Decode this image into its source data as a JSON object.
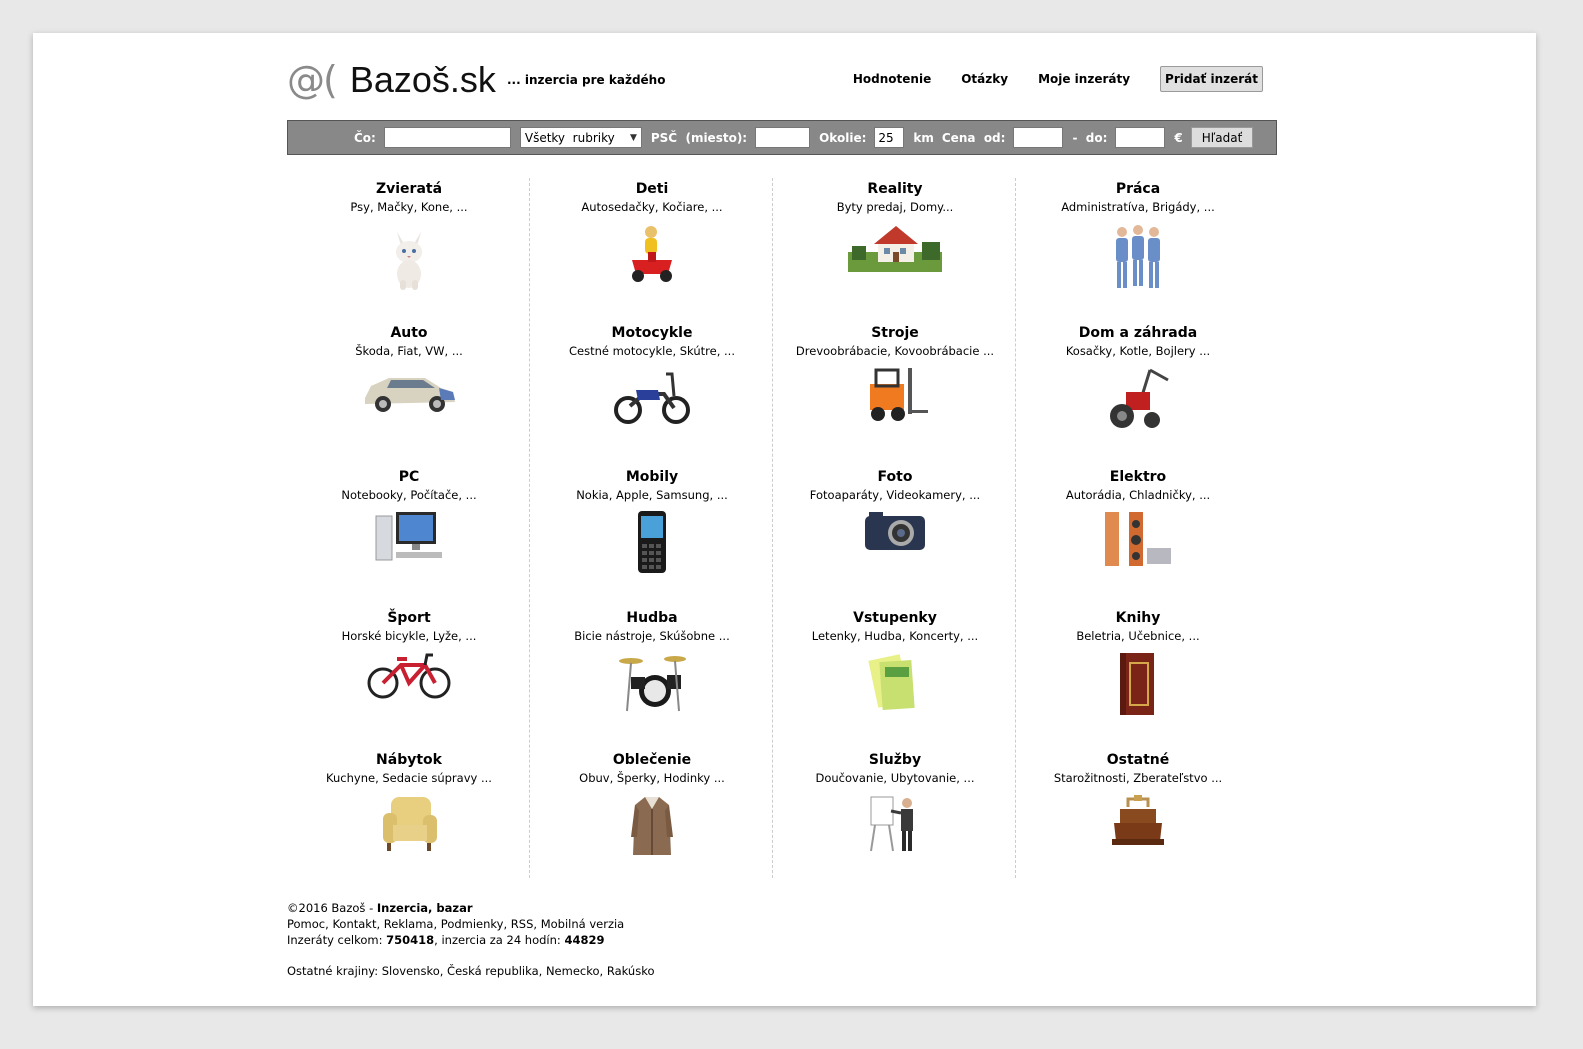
{
  "header": {
    "logo_at": "@(",
    "logo_text": "Bazoš.sk",
    "tagline": "... inzercia pre každého",
    "nav": [
      "Hodnotenie",
      "Otázky",
      "Moje inzeráty"
    ],
    "add_button": "Pridať inzerát"
  },
  "search": {
    "what_label": "Čo:",
    "what_value": "",
    "category_selected": "Všetky  rubriky",
    "zip_label": "PSČ  (miesto):",
    "zip_value": "",
    "radius_label": "Okolie:",
    "radius_value": "25",
    "km_label": "km",
    "price_from_label": "Cena  od:",
    "price_from_value": "",
    "price_to_label": "-  do:",
    "price_to_value": "",
    "currency": "€",
    "search_button": "Hľadať"
  },
  "categories": [
    {
      "title": "Zvieratá",
      "sub": "Psy, Mačky, Kone, ...",
      "icon": "cat-icon"
    },
    {
      "title": "Deti",
      "sub": "Autosedačky, Kočiare, ...",
      "icon": "child-toy-car-icon"
    },
    {
      "title": "Reality",
      "sub": "Byty predaj, Domy...",
      "icon": "house-icon"
    },
    {
      "title": "Práca",
      "sub": "Administratíva, Brigády, ...",
      "icon": "workers-icon"
    },
    {
      "title": "Auto",
      "sub": "Škoda, Fiat, VW, ...",
      "icon": "car-icon"
    },
    {
      "title": "Motocykle",
      "sub": "Cestné motocykle, Skútre, ...",
      "icon": "motorcycle-icon"
    },
    {
      "title": "Stroje",
      "sub": "Drevoobrábacie, Kovoobrábacie ...",
      "icon": "forklift-icon"
    },
    {
      "title": "Dom a záhrada",
      "sub": "Kosačky, Kotle, Bojlery ...",
      "icon": "tiller-icon"
    },
    {
      "title": "PC",
      "sub": "Notebooky, Počítače, ...",
      "icon": "computer-icon"
    },
    {
      "title": "Mobily",
      "sub": "Nokia, Apple, Samsung, ...",
      "icon": "mobile-phone-icon"
    },
    {
      "title": "Foto",
      "sub": "Fotoaparáty, Videokamery, ...",
      "icon": "camera-icon"
    },
    {
      "title": "Elektro",
      "sub": "Autorádia, Chladničky, ...",
      "icon": "speakers-icon"
    },
    {
      "title": "Šport",
      "sub": "Horské bicykle, Lyže, ...",
      "icon": "bicycle-icon"
    },
    {
      "title": "Hudba",
      "sub": "Bicie nástroje, Skúšobne ...",
      "icon": "drums-icon"
    },
    {
      "title": "Vstupenky",
      "sub": "Letenky, Hudba, Koncerty, ...",
      "icon": "tickets-icon"
    },
    {
      "title": "Knihy",
      "sub": "Beletria, Učebnice, ...",
      "icon": "book-icon"
    },
    {
      "title": "Nábytok",
      "sub": "Kuchyne, Sedacie súpravy ...",
      "icon": "armchair-icon"
    },
    {
      "title": "Oblečenie",
      "sub": "Obuv, Šperky, Hodinky ...",
      "icon": "coat-icon"
    },
    {
      "title": "Služby",
      "sub": "Doučovanie, Ubytovanie, ...",
      "icon": "presenter-icon"
    },
    {
      "title": "Ostatné",
      "sub": "Starožitnosti, Zberateľstvo ...",
      "icon": "antique-iron-icon"
    }
  ],
  "footer": {
    "copyright": "©2016 Bazoš - ",
    "copyright_bold": "Inzercia, bazar",
    "links": [
      "Pomoc",
      "Kontakt",
      "Reklama",
      "Podmienky",
      "RSS",
      "Mobilná verzia"
    ],
    "total_label": "Inzeráty celkom: ",
    "total_value": "750418",
    "day_label": ", inzercia za 24 hodín: ",
    "day_value": "44829",
    "countries_label": "Ostatné krajiny: ",
    "countries": [
      "Slovensko",
      "Česká republika",
      "Nemecko",
      "Rakúsko"
    ]
  },
  "colors": {
    "page_bg": "#e8e8e8",
    "content_bg": "#ffffff",
    "search_bar_bg": "#888888",
    "logo_at": "#8a8a8a"
  }
}
